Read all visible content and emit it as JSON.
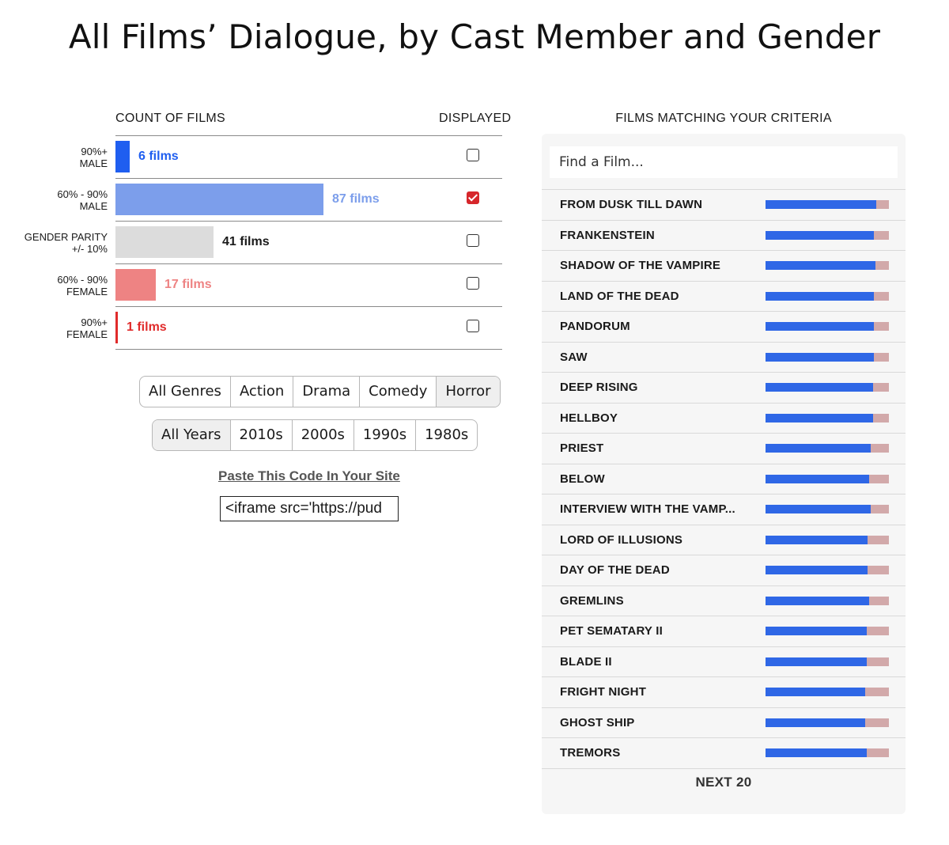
{
  "title": "All Films’ Dialogue, by Cast Member and Gender",
  "left": {
    "count_header": "COUNT OF FILMS",
    "displayed_header": "DISPLAYED"
  },
  "colors": {
    "male90": "#1f5ef0",
    "male60": "#7c9eeb",
    "parity": "#dcdcdc",
    "female60": "#ee8383",
    "female90": "#e02b2b",
    "film_male": "#2f67e6",
    "film_female": "#d2a9aa",
    "check_on": "#d6262b"
  },
  "chart_data": [
    {
      "type": "bar",
      "orientation": "horizontal",
      "title": "COUNT OF FILMS",
      "categories": [
        "90%+\nMALE",
        "60% - 90%\nMALE",
        "GENDER PARITY\n+/- 10%",
        "60% - 90%\nFEMALE",
        "90%+\nFEMALE"
      ],
      "category_lines": [
        [
          "90%+",
          "MALE"
        ],
        [
          "60% - 90%",
          "MALE"
        ],
        [
          "GENDER PARITY",
          "+/- 10%"
        ],
        [
          "60% - 90%",
          "FEMALE"
        ],
        [
          "90%+",
          "FEMALE"
        ]
      ],
      "values": [
        6,
        87,
        41,
        17,
        1
      ],
      "labels": [
        "6 films",
        "87 films",
        "41 films",
        "17 films",
        "1 films"
      ],
      "displayed": [
        false,
        true,
        false,
        false,
        false
      ],
      "xlim": [
        0,
        87
      ]
    },
    {
      "type": "bar",
      "orientation": "horizontal",
      "stacked": true,
      "title": "FILMS MATCHING YOUR CRITERIA",
      "categories": [
        "FROM DUSK TILL DAWN",
        "FRANKENSTEIN",
        "SHADOW OF THE VAMPIRE",
        "LAND OF THE DEAD",
        "PANDORUM",
        "SAW",
        "DEEP RISING",
        "HELLBOY",
        "PRIEST",
        "BELOW",
        "INTERVIEW WITH THE VAMP...",
        "LORD OF ILLUSIONS",
        "DAY OF THE DEAD",
        "GREMLINS",
        "PET SEMATARY II",
        "BLADE II",
        "FRIGHT NIGHT",
        "GHOST SHIP",
        "TREMORS"
      ],
      "male_share": [
        0.9,
        0.88,
        0.89,
        0.88,
        0.88,
        0.88,
        0.87,
        0.87,
        0.85,
        0.84,
        0.85,
        0.83,
        0.83,
        0.84,
        0.82,
        0.82,
        0.81,
        0.81,
        0.82
      ],
      "xlim": [
        0,
        1
      ]
    }
  ],
  "genres": {
    "items": [
      "All Genres",
      "Action",
      "Drama",
      "Comedy",
      "Horror"
    ],
    "selected": 4
  },
  "years": {
    "items": [
      "All Years",
      "2010s",
      "2000s",
      "1990s",
      "1980s"
    ],
    "selected": 0
  },
  "embed": {
    "label": "Paste This Code In Your Site",
    "code": "<iframe src='https://pud"
  },
  "right": {
    "header": "FILMS MATCHING YOUR CRITERIA",
    "search_placeholder": "Find a Film...",
    "next": "NEXT 20"
  }
}
